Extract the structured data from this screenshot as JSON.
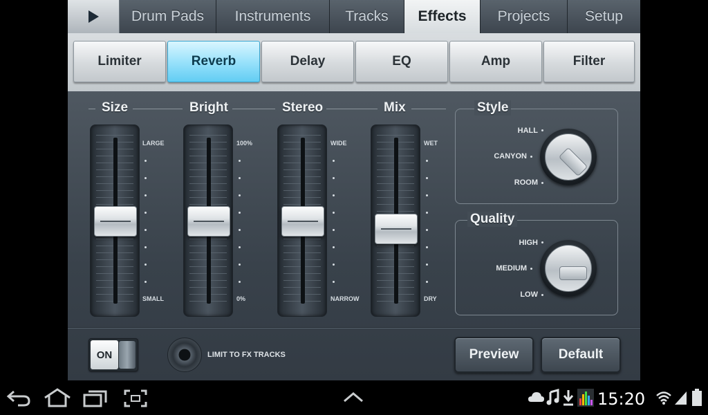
{
  "tabs": [
    {
      "label": "Drum Pads"
    },
    {
      "label": "Instruments"
    },
    {
      "label": "Tracks"
    },
    {
      "label": "Effects",
      "active": true
    },
    {
      "label": "Projects"
    },
    {
      "label": "Setup"
    }
  ],
  "effects": [
    {
      "label": "Limiter"
    },
    {
      "label": "Reverb",
      "active": true
    },
    {
      "label": "Delay"
    },
    {
      "label": "EQ"
    },
    {
      "label": "Amp"
    },
    {
      "label": "Filter"
    }
  ],
  "sliders": [
    {
      "label": "Size",
      "top": "LARGE",
      "bottom": "SMALL",
      "level": 0.5
    },
    {
      "label": "Bright",
      "top": "100%",
      "bottom": "0%",
      "level": 0.5
    },
    {
      "label": "Stereo",
      "top": "WIDE",
      "bottom": "NARROW",
      "level": 0.5
    },
    {
      "label": "Mix",
      "top": "WET",
      "bottom": "DRY",
      "level": 0.45
    }
  ],
  "style": {
    "title": "Style",
    "options": [
      "HALL",
      "CANYON",
      "ROOM"
    ],
    "selected": "HALL"
  },
  "quality": {
    "title": "Quality",
    "options": [
      "HIGH",
      "MEDIUM",
      "LOW"
    ],
    "selected": "MEDIUM"
  },
  "bottom": {
    "toggle": "ON",
    "limit_label": "LIMIT TO FX TRACKS",
    "preview": "Preview",
    "default": "Default"
  },
  "status": {
    "clock": "15:20"
  },
  "colors": {
    "accent": "#7fd8f8",
    "panel": "#3f4850"
  }
}
